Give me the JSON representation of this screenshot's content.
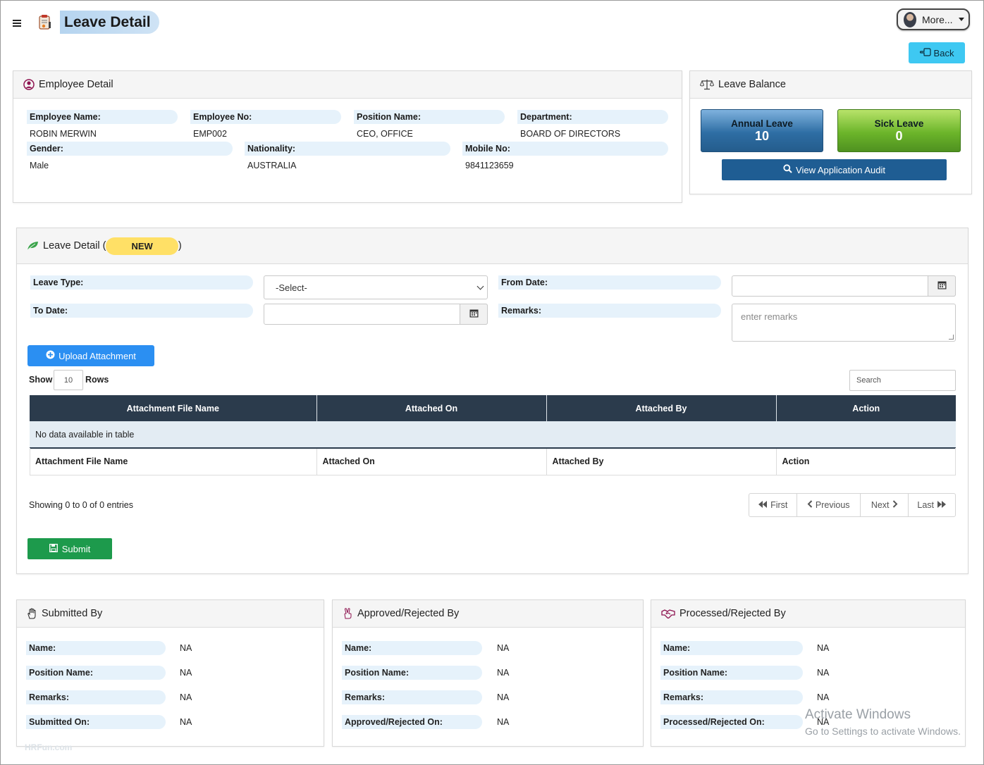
{
  "header": {
    "title": "Leave Detail",
    "more_label": "More...",
    "back_label": "Back"
  },
  "employee_panel": {
    "title": "Employee Detail",
    "fields": {
      "employee_name_label": "Employee Name:",
      "employee_name": "ROBIN MERWIN",
      "employee_no_label": "Employee No:",
      "employee_no": "EMP002",
      "position_name_label": "Position Name:",
      "position_name": "CEO, OFFICE",
      "department_label": "Department:",
      "department": "BOARD OF DIRECTORS",
      "gender_label": "Gender:",
      "gender": "Male",
      "nationality_label": "Nationality:",
      "nationality": "AUSTRALIA",
      "mobile_label": "Mobile No:",
      "mobile": "9841123659"
    }
  },
  "leave_balance": {
    "title": "Leave Balance",
    "annual_label": "Annual Leave",
    "annual_value": "10",
    "sick_label": "Sick Leave",
    "sick_value": "0",
    "audit_button": "View Application Audit",
    "colors": {
      "annual": "#2e6ea4",
      "sick": "#5da42a"
    }
  },
  "leave_form": {
    "title_prefix": "Leave Detail (",
    "status_badge": "NEW",
    "title_suffix": ")",
    "leave_type_label": "Leave Type:",
    "leave_type_value": "-Select-",
    "from_date_label": "From Date:",
    "to_date_label": "To Date:",
    "remarks_label": "Remarks:",
    "remarks_placeholder": "enter remarks",
    "upload_button": "Upload Attachment",
    "show_label": "Show",
    "rows_value": "10",
    "rows_label": "Rows",
    "search_placeholder": "Search",
    "table": {
      "columns": [
        "Attachment File Name",
        "Attached On",
        "Attached By",
        "Action"
      ],
      "empty_message": "No data available in table",
      "footer_columns": [
        "Attachment File Name",
        "Attached On",
        "Attached By",
        "Action"
      ]
    },
    "showing_text": "Showing 0 to 0 of 0 entries",
    "pager": {
      "first": "First",
      "previous": "Previous",
      "next": "Next",
      "last": "Last"
    },
    "submit_button": "Submit"
  },
  "submitted_by": {
    "title": "Submitted By",
    "rows": [
      {
        "label": "Name:",
        "value": "NA"
      },
      {
        "label": "Position Name:",
        "value": "NA"
      },
      {
        "label": "Remarks:",
        "value": "NA"
      },
      {
        "label": "Submitted On:",
        "value": "NA"
      }
    ]
  },
  "approved_by": {
    "title": "Approved/Rejected By",
    "rows": [
      {
        "label": "Name:",
        "value": "NA"
      },
      {
        "label": "Position Name:",
        "value": "NA"
      },
      {
        "label": "Remarks:",
        "value": "NA"
      },
      {
        "label": "Approved/Rejected On:",
        "value": "NA"
      }
    ]
  },
  "processed_by": {
    "title": "Processed/Rejected By",
    "rows": [
      {
        "label": "Name:",
        "value": "NA"
      },
      {
        "label": "Position Name:",
        "value": "NA"
      },
      {
        "label": "Remarks:",
        "value": "NA"
      },
      {
        "label": "Processed/Rejected On:",
        "value": "NA"
      }
    ]
  },
  "footer": {
    "brand": "HRFun.com"
  },
  "os_watermark": {
    "line1": "Activate Windows",
    "line2": "Go to Settings to activate Windows."
  }
}
